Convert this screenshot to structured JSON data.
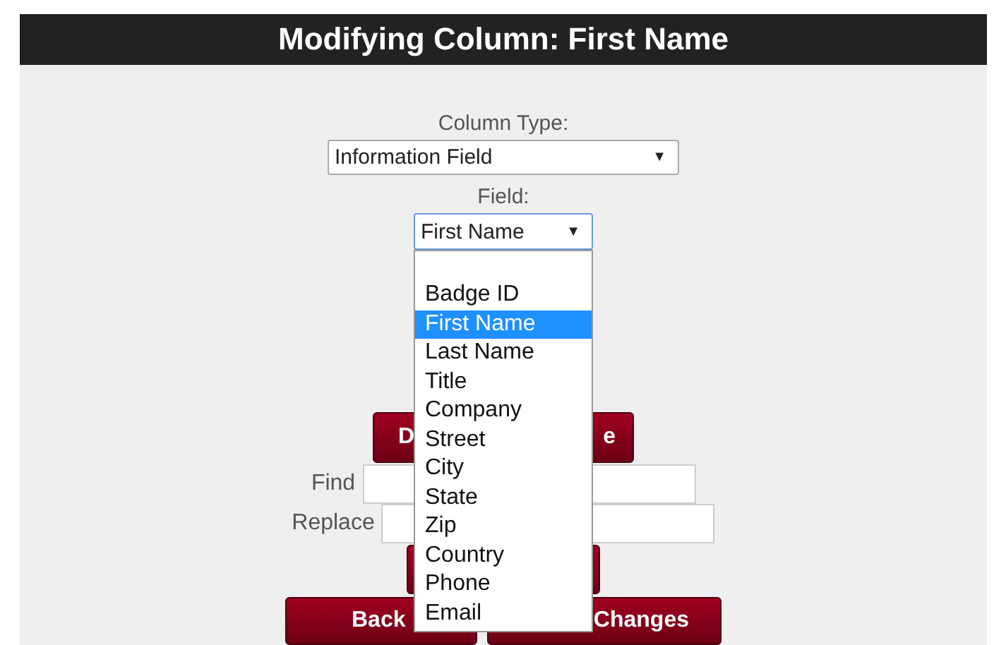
{
  "header": {
    "title": "Modifying Column: First Name"
  },
  "column_type": {
    "label": "Column Type:",
    "value": "Information Field",
    "arrow": "▼"
  },
  "field": {
    "label": "Field:",
    "value": "First Name",
    "arrow": "▼",
    "expanded": true,
    "options": [
      {
        "label": "Badge ID",
        "selected": false
      },
      {
        "label": "First Name",
        "selected": true
      },
      {
        "label": "Last Name",
        "selected": false
      },
      {
        "label": "Title",
        "selected": false
      },
      {
        "label": "Company",
        "selected": false
      },
      {
        "label": "Street",
        "selected": false
      },
      {
        "label": "City",
        "selected": false
      },
      {
        "label": "State",
        "selected": false
      },
      {
        "label": "Zip",
        "selected": false
      },
      {
        "label": "Country",
        "selected": false
      },
      {
        "label": "Phone",
        "selected": false
      },
      {
        "label": "Email",
        "selected": false
      }
    ]
  },
  "top_button": {
    "left_text": "D",
    "right_text": "e"
  },
  "find": {
    "label": "Find"
  },
  "replace": {
    "label": "Replace"
  },
  "bottom_buttons": [
    {
      "left_text": "Back"
    },
    {
      "right_text": "Changes"
    }
  ]
}
